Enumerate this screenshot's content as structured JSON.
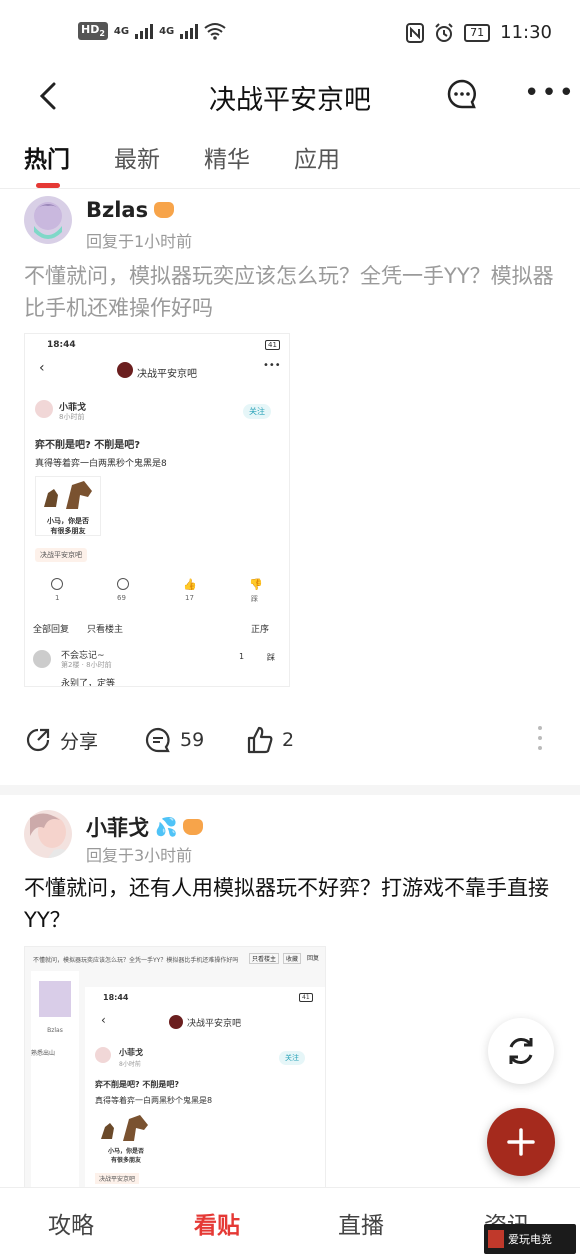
{
  "status_bar": {
    "hd_label": "HD",
    "hd_sub": "2",
    "net1": "4G",
    "net2": "4G",
    "battery": "71",
    "time": "11:30"
  },
  "header": {
    "title": "决战平安京吧"
  },
  "tabs": [
    {
      "label": "热门",
      "active": true
    },
    {
      "label": "最新",
      "active": false
    },
    {
      "label": "精华",
      "active": false
    },
    {
      "label": "应用",
      "active": false
    }
  ],
  "posts": [
    {
      "username": "Bzlas",
      "time": "回复于1小时前",
      "text": "不懂就问，模拟器玩奕应该怎么玩？全凭一手YY？模拟器比手机还难操作好吗",
      "share_label": "分享",
      "comment_count": "59",
      "like_count": "2",
      "screenshot": {
        "time": "18:44",
        "battery": "41",
        "title": "决战平安京吧",
        "username": "小菲戈",
        "post_time": "8小时前",
        "follow_label": "关注",
        "post_title": "弈不削是吧? 不削是吧?",
        "post_body": "真得等着弈一白两黑秒个鬼黑是8",
        "meme_caption_1": "小马，你是否",
        "meme_caption_2": "有很多朋友",
        "tag": "决战平安京吧",
        "stat_share": "1",
        "stat_comment": "69",
        "stat_like": "17",
        "stat_dislike": "踩",
        "tab_all": "全部回复",
        "tab_op": "只看楼主",
        "sort": "正序",
        "reply_user": "不会忘记~",
        "reply_meta": "第2楼 · 8小时前",
        "reply_like": "1",
        "reply_dislike": "踩",
        "reply_text": "永别了，定等"
      }
    },
    {
      "username": "小菲戈",
      "time": "回复于3小时前",
      "text": "不懂就问，还有人用模拟器玩不好弈？打游戏不靠手直接YY？",
      "screenshot": {
        "top_text": "不懂就问，模拟器玩奕应该怎么玩？全凭一手YY？模拟器比手机还难操作好吗",
        "btn_op": "只看楼主",
        "btn_fav": "收藏",
        "btn_reply": "回复",
        "side_user": "Bzlas",
        "side_badge": "熟悉出山",
        "time": "18:44",
        "battery": "41",
        "title": "决战平安京吧",
        "username": "小菲戈",
        "post_time": "8小时前",
        "follow_label": "关注",
        "post_title": "弈不削是吧? 不削是吧?",
        "post_body": "真得等着弈一白两黑秒个鬼黑是8",
        "meme_caption_1": "小马，你是否",
        "meme_caption_2": "有很多朋友",
        "tag": "决战平安京吧"
      }
    }
  ],
  "bottom_nav": [
    {
      "label": "攻略",
      "active": false
    },
    {
      "label": "看贴",
      "active": true
    },
    {
      "label": "直播",
      "active": false
    },
    {
      "label": "资讯",
      "active": false
    }
  ],
  "watermark": "爱玩电竞",
  "colors": {
    "accent": "#e53935",
    "fab": "#a52a1d"
  }
}
